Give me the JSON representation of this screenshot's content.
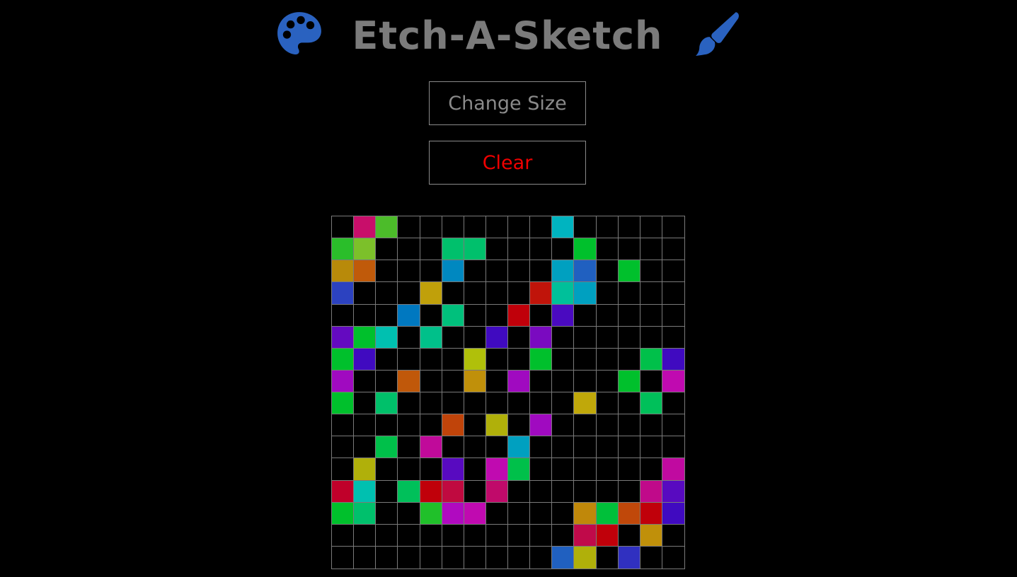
{
  "header": {
    "title": "Etch-A-Sketch",
    "left_icon": "palette-icon",
    "right_icon": "paint-brush-icon",
    "icon_color": "#2a62c0",
    "title_color": "#7b7b7b"
  },
  "controls": {
    "change_size_label": "Change Size",
    "clear_label": "Clear",
    "clear_color": "#f00000"
  },
  "grid": {
    "size": 16,
    "line_color": "#7a7a7a",
    "background": "#000000",
    "cells": [
      [
        null,
        "#c80e6a",
        "#4cbc2a",
        null,
        null,
        null,
        null,
        null,
        null,
        null,
        "#00b4c0",
        null,
        null,
        null,
        null,
        null
      ],
      [
        "#2abe2a",
        "#7cc02a",
        null,
        null,
        null,
        "#00c06c",
        "#00c06c",
        null,
        null,
        null,
        null,
        "#00c02c",
        null,
        null,
        null,
        null
      ],
      [
        "#b88a0a",
        "#c05a0a",
        null,
        null,
        null,
        "#0088c0",
        null,
        null,
        null,
        null,
        "#00a0c0",
        "#2060c0",
        null,
        "#00c02c",
        null,
        null
      ],
      [
        "#2c42c0",
        null,
        null,
        null,
        "#c0a00a",
        null,
        null,
        null,
        null,
        "#c0140a",
        "#00c09a",
        "#00a0c0",
        null,
        null,
        null,
        null
      ],
      [
        null,
        null,
        null,
        "#0078c0",
        null,
        "#00c07c",
        null,
        null,
        "#c0000a",
        null,
        "#4a0ac0",
        null,
        null,
        null,
        null,
        null
      ],
      [
        "#640ac0",
        "#00c02c",
        "#00c0b0",
        null,
        "#00c08a",
        null,
        null,
        "#400ac0",
        null,
        "#7a0ac0",
        null,
        null,
        null,
        null,
        null,
        null
      ],
      [
        "#00c02c",
        "#400ac0",
        null,
        null,
        null,
        null,
        "#b0c00a",
        null,
        null,
        "#00c02c",
        null,
        null,
        null,
        null,
        "#00c04a",
        "#400ac0"
      ],
      [
        "#a00ac0",
        null,
        null,
        "#c0580a",
        null,
        null,
        "#c0900a",
        null,
        "#a00ac0",
        null,
        null,
        null,
        null,
        "#00c02c",
        null,
        "#c00ab0"
      ],
      [
        "#00c02c",
        null,
        "#00c06a",
        null,
        null,
        null,
        null,
        null,
        null,
        null,
        null,
        "#c0a80a",
        null,
        null,
        "#00c05a",
        null
      ],
      [
        null,
        null,
        null,
        null,
        null,
        "#c0440a",
        null,
        "#b0b00a",
        null,
        "#a00ac0",
        null,
        null,
        null,
        null,
        null,
        null
      ],
      [
        null,
        null,
        "#00c04a",
        null,
        "#c00a9a",
        null,
        null,
        null,
        "#00a0c0",
        null,
        null,
        null,
        null,
        null,
        null,
        null
      ],
      [
        null,
        "#b0b00a",
        null,
        null,
        null,
        "#580ac0",
        null,
        "#c00ab0",
        "#00c04a",
        null,
        null,
        null,
        null,
        null,
        null,
        "#c00aa0"
      ],
      [
        "#c0002a",
        "#00c0b0",
        null,
        "#00c05a",
        "#c0000a",
        "#c00a40",
        null,
        "#c00a6a",
        null,
        null,
        null,
        null,
        null,
        null,
        "#c00a8a",
        "#580ac0"
      ],
      [
        "#00c02c",
        "#00c06c",
        null,
        null,
        "#20c02a",
        "#b00ac0",
        "#c00ab0",
        null,
        null,
        null,
        null,
        "#c0880a",
        "#00c03a",
        "#c0480a",
        "#c0000a",
        "#400ac0"
      ],
      [
        null,
        null,
        null,
        null,
        null,
        null,
        null,
        null,
        null,
        null,
        null,
        "#c00a4a",
        "#c0000a",
        null,
        "#c0900a",
        null
      ],
      [
        null,
        null,
        null,
        null,
        null,
        null,
        null,
        null,
        null,
        null,
        "#2060c0",
        "#b0b00a",
        null,
        "#3030c0",
        null,
        null
      ]
    ]
  }
}
